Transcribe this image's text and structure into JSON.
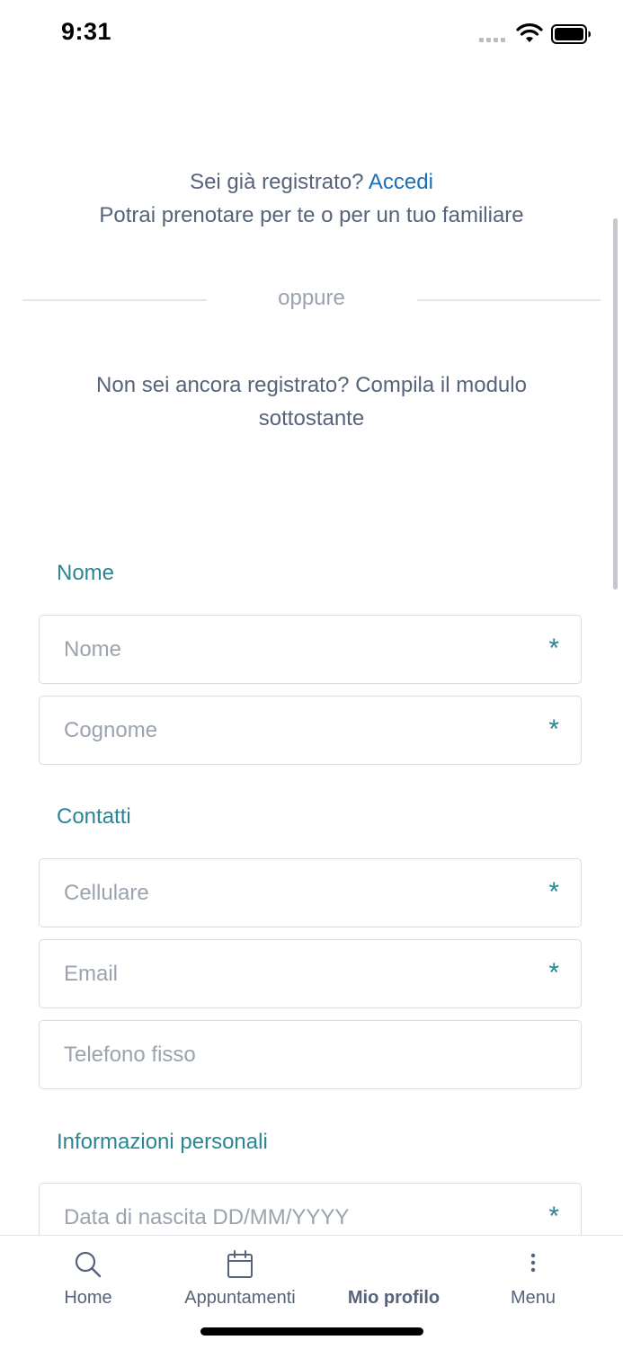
{
  "status_bar": {
    "time": "9:31"
  },
  "intro": {
    "already_registered": "Sei già registrato?",
    "login_link": "Accedi",
    "subtitle": "Potrai prenotare per te o per un tuo familiare"
  },
  "divider": {
    "label": "oppure"
  },
  "register_prompt": "Non sei ancora registrato? Compila il modulo sottostante",
  "sections": {
    "nome": "Nome",
    "contatti": "Contatti",
    "info": "Informazioni personali"
  },
  "fields": {
    "nome": {
      "placeholder": "Nome",
      "required": "*"
    },
    "cognome": {
      "placeholder": "Cognome",
      "required": "*"
    },
    "cellulare": {
      "placeholder": "Cellulare",
      "required": "*"
    },
    "email": {
      "placeholder": "Email",
      "required": "*"
    },
    "telefono": {
      "placeholder": "Telefono fisso"
    },
    "nascita": {
      "placeholder": "Data di nascita DD/MM/YYYY",
      "required": "*"
    }
  },
  "tabbar": {
    "home": {
      "label": "Home",
      "icon": "search-icon"
    },
    "appuntamenti": {
      "label": "Appuntamenti",
      "icon": "calendar-icon"
    },
    "profilo": {
      "label": "Mio profilo",
      "active": true
    },
    "menu": {
      "label": "Menu",
      "icon": "more-vertical-icon"
    }
  },
  "colors": {
    "accent": "#2b8594",
    "link": "#1a6fb9",
    "text": "#56637a",
    "placeholder": "#9aa3ae"
  }
}
